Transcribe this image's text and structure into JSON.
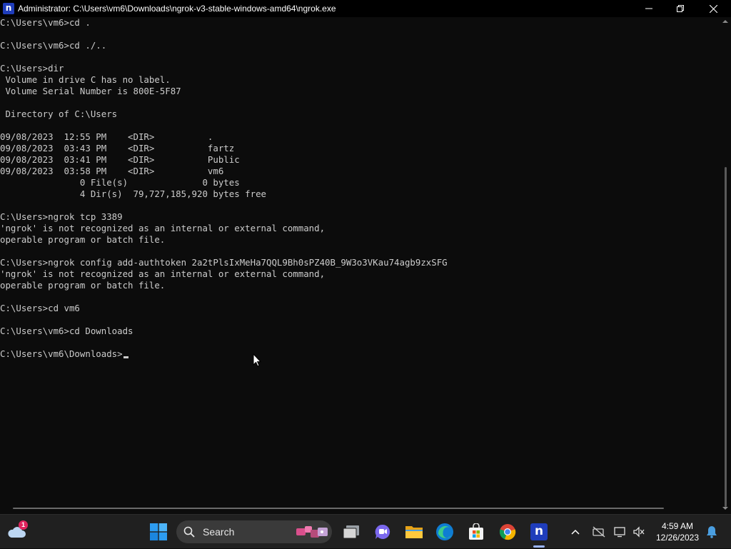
{
  "window": {
    "app_icon": "n",
    "title": "Administrator: C:\\Users\\vm6\\Downloads\\ngrok-v3-stable-windows-amd64\\ngrok.exe",
    "controls": [
      "minimize-icon",
      "restore-icon",
      "close-icon"
    ]
  },
  "console": {
    "lines": [
      "C:\\Users\\vm6>cd .",
      "",
      "C:\\Users\\vm6>cd ./..",
      "",
      "C:\\Users>dir",
      " Volume in drive C has no label.",
      " Volume Serial Number is 800E-5F87",
      "",
      " Directory of C:\\Users",
      "",
      "09/08/2023  12:55 PM    <DIR>          .",
      "09/08/2023  03:43 PM    <DIR>          fartz",
      "09/08/2023  03:41 PM    <DIR>          Public",
      "09/08/2023  03:58 PM    <DIR>          vm6",
      "               0 File(s)              0 bytes",
      "               4 Dir(s)  79,727,185,920 bytes free",
      "",
      "C:\\Users>ngrok tcp 3389",
      "'ngrok' is not recognized as an internal or external command,",
      "operable program or batch file.",
      "",
      "C:\\Users>ngrok config add-authtoken 2a2tPlsIxMeHa7QQL9Bh0sPZ40B_9W3o3VKau74agb9zxSFG",
      "'ngrok' is not recognized as an internal or external command,",
      "operable program or batch file.",
      "",
      "C:\\Users>cd vm6",
      "",
      "C:\\Users\\vm6>cd Downloads",
      ""
    ],
    "prompt": "C:\\Users\\vm6\\Downloads>"
  },
  "taskbar": {
    "weather_badge": "1",
    "search_label": "Search",
    "icons": [
      "start-icon",
      "search-icon",
      "task-view-icon",
      "chat-icon",
      "file-explorer-icon",
      "edge-icon",
      "store-icon",
      "chrome-icon",
      "ngrok-icon"
    ],
    "ngrok_app_letter": "n",
    "tray_icons": [
      "show-hidden-icons-chevron",
      "network-off-icon",
      "display-icon",
      "volume-muted-icon",
      "notification-bell-icon"
    ],
    "time": "4:59 AM",
    "date": "12/26/2023"
  },
  "colors": {
    "console_bg": "#0c0c0c",
    "console_text": "#cccccc",
    "taskbar_bg": "#202020",
    "accent": "#1f3dbb"
  }
}
